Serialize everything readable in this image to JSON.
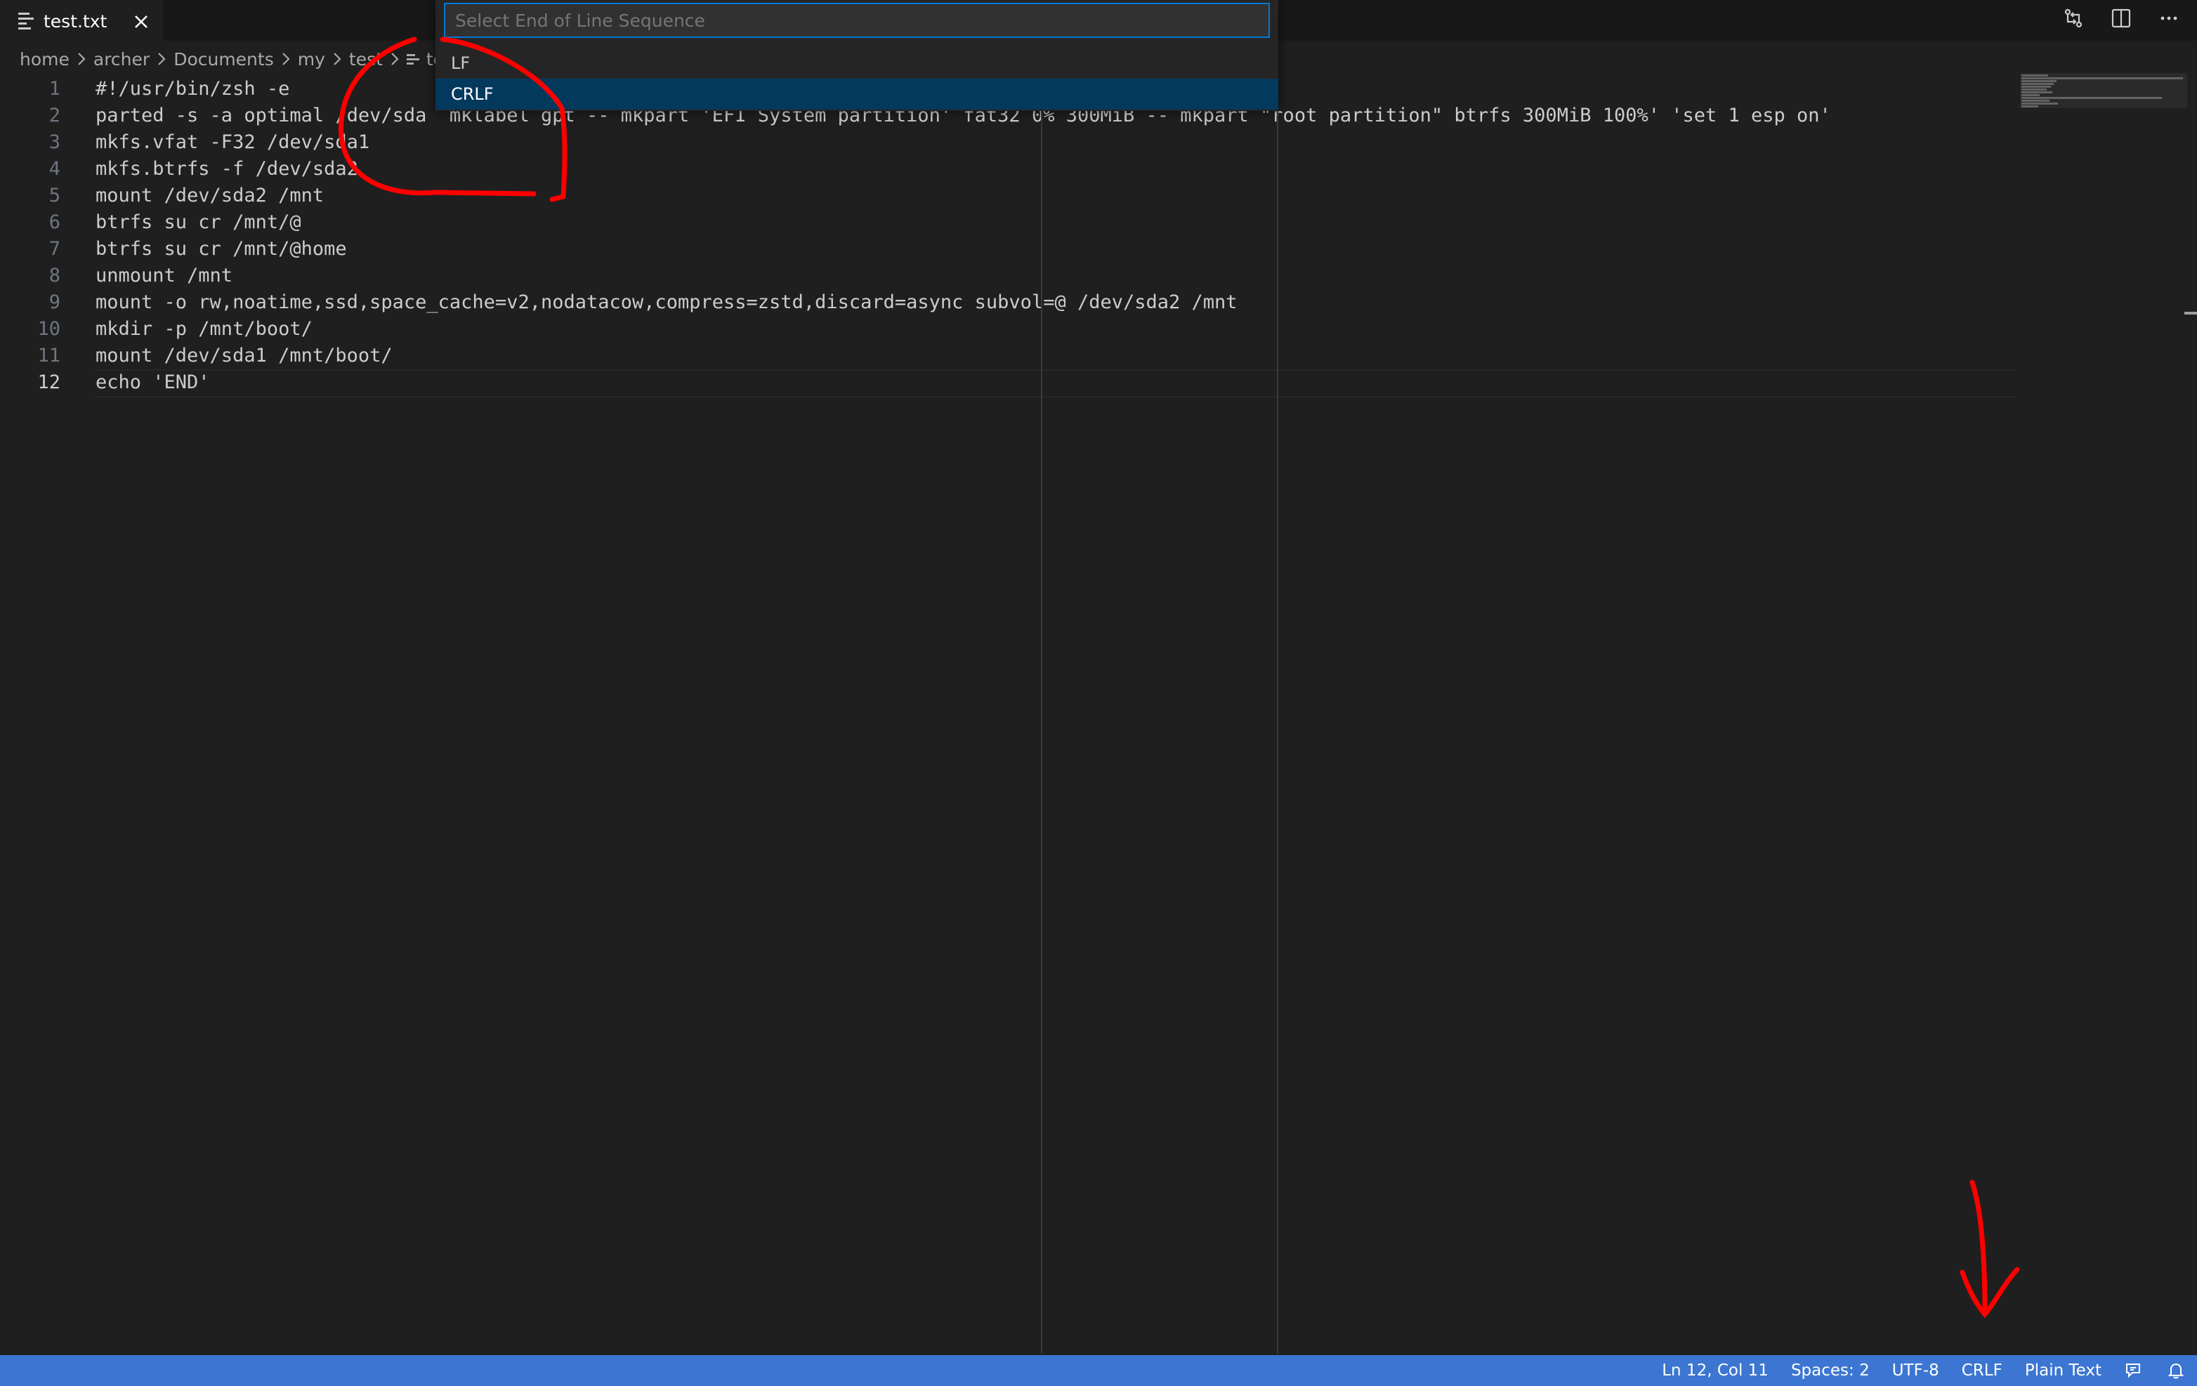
{
  "tab": {
    "label": "test.txt",
    "icon": "file-lines-icon"
  },
  "breadcrumb": [
    "home",
    "archer",
    "Documents",
    "my",
    "test",
    "tes"
  ],
  "quickpick": {
    "placeholder": "Select End of Line Sequence",
    "items": [
      "LF",
      "CRLF"
    ],
    "selected_index": 1
  },
  "editor": {
    "lines": [
      {
        "number": "1",
        "text": "#!/usr/bin/zsh -e"
      },
      {
        "number": "2",
        "text": "parted -s -a optimal /dev/sda  mklabel gpt -- mkpart 'EFI System partition' fat32 0% 300MiB -- mkpart \"root partition\" btrfs 300MiB 100%' 'set 1 esp on'"
      },
      {
        "number": "3",
        "text": "mkfs.vfat -F32 /dev/sda1"
      },
      {
        "number": "4",
        "text": "mkfs.btrfs -f /dev/sda2"
      },
      {
        "number": "5",
        "text": "mount /dev/sda2 /mnt"
      },
      {
        "number": "6",
        "text": "btrfs su cr /mnt/@"
      },
      {
        "number": "7",
        "text": "btrfs su cr /mnt/@home"
      },
      {
        "number": "8",
        "text": "unmount /mnt"
      },
      {
        "number": "9",
        "text": "mount -o rw,noatime,ssd,space_cache=v2,nodatacow,compress=zstd,discard=async subvol=@ /dev/sda2 /mnt"
      },
      {
        "number": "10",
        "text": "mkdir -p /mnt/boot/"
      },
      {
        "number": "11",
        "text": "mount /dev/sda1 /mnt/boot/"
      },
      {
        "number": "12",
        "text": "echo 'END'"
      }
    ],
    "current_line": "12"
  },
  "statusbar": {
    "position": "Ln 12, Col 11",
    "indentation": "Spaces: 2",
    "encoding": "UTF-8",
    "eol": "CRLF",
    "language": "Plain Text"
  },
  "colors": {
    "editor_bg": "#1f1f1f",
    "statusbar_bg": "#3c76d2",
    "selection_bg": "#04395e",
    "focus_border": "#0078d4",
    "annotation_red": "#ff0000"
  },
  "icons": [
    "file-lines-icon",
    "close-icon",
    "chevron-right-icon",
    "compare-changes-icon",
    "split-editor-icon",
    "more-actions-icon",
    "feedback-icon",
    "bell-icon"
  ]
}
